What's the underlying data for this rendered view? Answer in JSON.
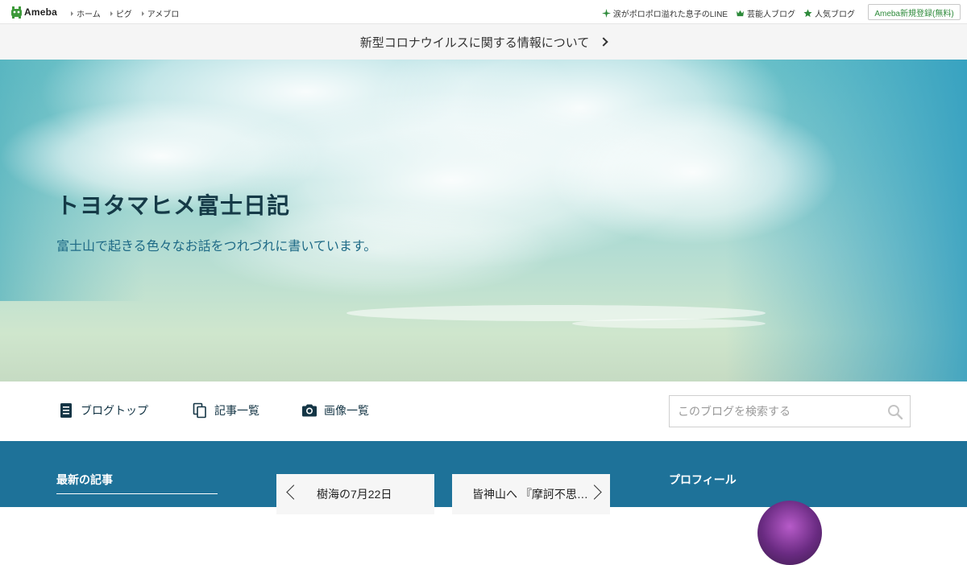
{
  "topbar": {
    "brand": "Ameba",
    "nav": [
      {
        "label": "ホーム"
      },
      {
        "label": "ピグ"
      },
      {
        "label": "アメブロ"
      }
    ],
    "right": [
      {
        "label": "涙がポロポロ溢れた息子のLINE",
        "icon": "sparkle-icon"
      },
      {
        "label": "芸能人ブログ",
        "icon": "crown-icon"
      },
      {
        "label": "人気ブログ",
        "icon": "star-icon"
      }
    ],
    "register_label": "Ameba新規登録(無料)",
    "accent": "#2d8a3a"
  },
  "announcement": {
    "label": "新型コロナウイルスに関する情報について"
  },
  "hero": {
    "title": "トヨタマヒメ富士日記",
    "description": "富士山で起きる色々なお話をつれづれに書いています。"
  },
  "blognav": {
    "items": [
      {
        "label": "ブログトップ",
        "icon": "document-icon"
      },
      {
        "label": "記事一覧",
        "icon": "copy-icon"
      },
      {
        "label": "画像一覧",
        "icon": "camera-icon"
      }
    ],
    "search_placeholder": "このブログを検索する"
  },
  "main": {
    "latest_title": "最新の記事",
    "prev_article": "樹海の7月22日",
    "next_article": "皆神山へ 『摩訶不思…",
    "profile_title": "プロフィール",
    "bg_color": "#1e7299"
  }
}
